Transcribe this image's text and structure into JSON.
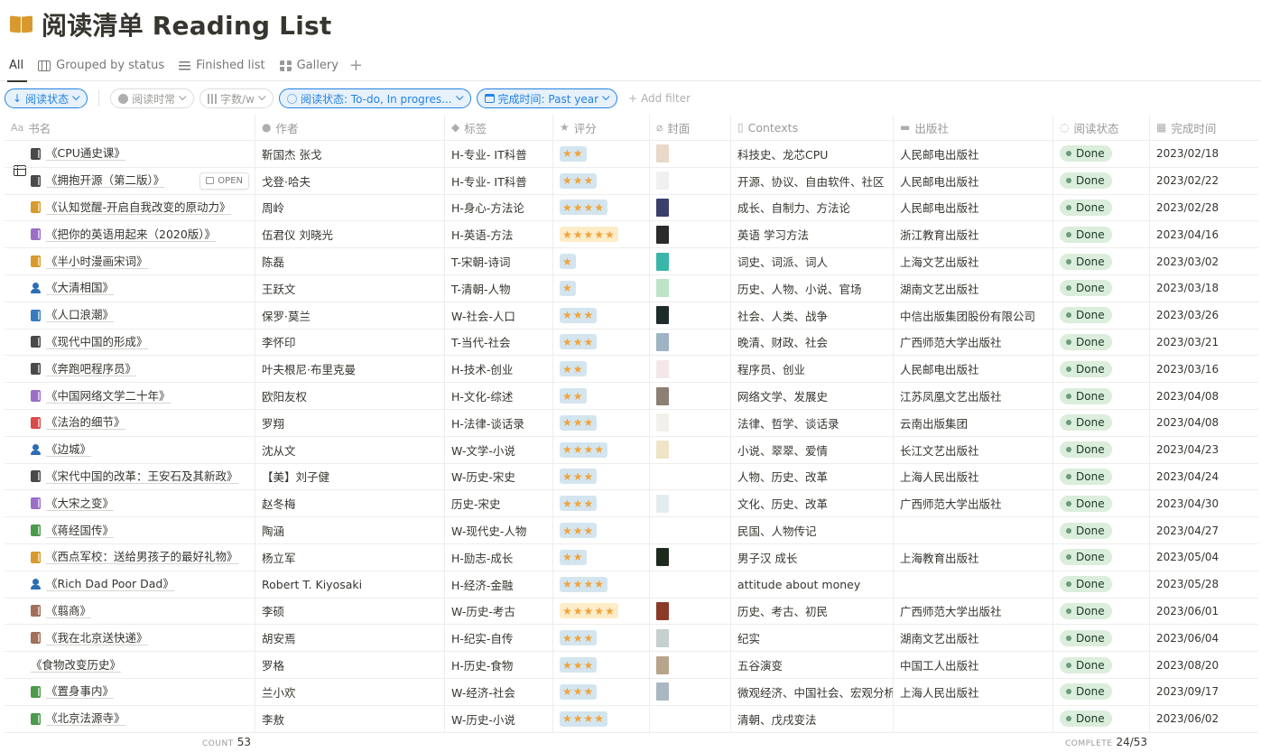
{
  "page": {
    "title": "阅读清单 Reading List",
    "icon": "open-book-icon"
  },
  "views": [
    {
      "label": "All",
      "icon": "table-icon",
      "active": true
    },
    {
      "label": "Grouped by status",
      "icon": "board-icon"
    },
    {
      "label": "Finished list",
      "icon": "list-icon"
    },
    {
      "label": "Gallery",
      "icon": "gallery-icon"
    }
  ],
  "filters": {
    "sort": "阅读状态",
    "f1": "阅读时常",
    "f2": "字数/w",
    "f3": "阅读状态: To-do, In progres...",
    "f4": "完成时间: Past year",
    "add": "Add filter"
  },
  "columns": {
    "name": "书名",
    "author": "作者",
    "tag": "标签",
    "rating": "评分",
    "cover": "封面",
    "contexts": "Contexts",
    "publisher": "出版社",
    "status": "阅读状态",
    "date": "完成时间"
  },
  "open_label": "OPEN",
  "rows": [
    {
      "name": "《CPU通史课》",
      "icon": "book",
      "color": "#4a4a4a",
      "author": "靳国杰 张戈",
      "tag": "H-专业- IT科普",
      "stars": "★★",
      "cover": "#e8d9c9",
      "ctx": "科技史、龙芯CPU",
      "pub": "人民邮电出版社",
      "status": "Done",
      "date": "2023/02/18"
    },
    {
      "name": "《拥抱开源（第二版）》",
      "icon": "book",
      "color": "#4a4a4a",
      "author": "戈登·哈夫",
      "tag": "H-专业- IT科普",
      "stars": "★★★",
      "cover": "#f0f0f0",
      "ctx": "开源、协议、自由软件、社区",
      "pub": "人民邮电出版社",
      "status": "Done",
      "date": "2023/02/22"
    },
    {
      "name": "《认知觉醒-开启自我改变的原动力》",
      "icon": "book",
      "color": "#d89a2e",
      "author": "周岭",
      "tag": "H-身心-方法论",
      "stars": "★★★★",
      "cover": "#3b3f6b",
      "ctx": "成长、自制力、方法论",
      "pub": "人民邮电出版社",
      "status": "Done",
      "date": "2023/02/28"
    },
    {
      "name": "《把你的英语用起来（2020版）》",
      "icon": "book",
      "color": "#9b6fc8",
      "author": "伍君仪 刘晓光",
      "tag": "H-英语-方法",
      "stars": "★★★★★",
      "stars_alt": true,
      "cover": "#2b2b2b",
      "ctx": "英语 学习方法",
      "pub": "浙江教育出版社",
      "status": "Done",
      "date": "2023/04/16"
    },
    {
      "name": "《半小时漫画宋词》",
      "icon": "book",
      "color": "#d89a2e",
      "author": "陈磊",
      "tag": "T-宋朝-诗词",
      "stars": "★",
      "cover": "#39b6a8",
      "ctx": "词史、词派、词人",
      "pub": "上海文艺出版社",
      "status": "Done",
      "date": "2023/03/02"
    },
    {
      "name": "《大清相国》",
      "icon": "person",
      "color": "#2c6db5",
      "author": "王跃文",
      "tag": "T-清朝-人物",
      "stars": "★",
      "cover": "#bfe3c7",
      "ctx": "历史、人物、小说、官场",
      "pub": "湖南文艺出版社",
      "status": "Done",
      "date": "2023/03/18"
    },
    {
      "name": "《人口浪潮》",
      "icon": "book",
      "color": "#3a7bbf",
      "author": "保罗·莫兰",
      "tag": "W-社会-人口",
      "stars": "★★★",
      "cover": "#1d2b2a",
      "ctx": "社会、人类、战争",
      "pub": "中信出版集团股份有限公司",
      "status": "Done",
      "date": "2023/03/26"
    },
    {
      "name": "《现代中国的形成》",
      "icon": "book",
      "color": "#4a4a4a",
      "author": "李怀印",
      "tag": "T-当代-社会",
      "stars": "★★★",
      "cover": "#9fb3c4",
      "ctx": "晚清、财政、社会",
      "pub": "广西师范大学出版社",
      "status": "Done",
      "date": "2023/03/21"
    },
    {
      "name": "《奔跑吧程序员》",
      "icon": "book",
      "color": "#4a4a4a",
      "author": "叶夫根尼·布里克曼",
      "tag": "H-技术-创业",
      "stars": "★★",
      "cover": "#f3e7ea",
      "ctx": "程序员、创业",
      "pub": "人民邮电出版社",
      "status": "Done",
      "date": "2023/03/16"
    },
    {
      "name": "《中国网络文学二十年》",
      "icon": "book",
      "color": "#9b6fc8",
      "author": "欧阳友权",
      "tag": "H-文化-综述",
      "stars": "★★",
      "cover": "#8c7f73",
      "ctx": "网络文学、发展史",
      "pub": "江苏凤凰文艺出版社",
      "status": "Done",
      "date": "2023/04/08"
    },
    {
      "name": "《法治的细节》",
      "icon": "book",
      "color": "#d94a4a",
      "author": "罗翔",
      "tag": "H-法律-谈话录",
      "stars": "★★★",
      "cover": "#f2f0ea",
      "ctx": "法律、哲学、谈话录",
      "pub": "云南出版集团",
      "status": "Done",
      "date": "2023/04/08"
    },
    {
      "name": "《边城》",
      "icon": "person",
      "color": "#2c6db5",
      "author": "沈从文",
      "tag": "W-文学-小说",
      "stars": "★★★★",
      "cover": "#efe3c8",
      "ctx": "小说、翠翠、爱情",
      "pub": "长江文艺出版社",
      "status": "Done",
      "date": "2023/04/23"
    },
    {
      "name": "《宋代中国的改革：王安石及其新政》",
      "icon": "book",
      "color": "#4a4a4a",
      "author": "【美】刘子健",
      "tag": "W-历史-宋史",
      "stars": "★★★",
      "cover": "",
      "ctx": "人物、历史、改革",
      "pub": "上海人民出版社",
      "status": "Done",
      "date": "2023/04/24"
    },
    {
      "name": "《大宋之变》",
      "icon": "book",
      "color": "#9b6fc8",
      "author": "赵冬梅",
      "tag": "历史-宋史",
      "stars": "★★★",
      "cover": "#e4ebee",
      "ctx": "文化、历史、改革",
      "pub": "广西师范大学出版社",
      "status": "Done",
      "date": "2023/04/30"
    },
    {
      "name": "《蒋经国传》",
      "icon": "book",
      "color": "#4c9a4c",
      "author": "陶涵",
      "tag": "W-现代史-人物",
      "stars": "★★★",
      "cover": "",
      "ctx": "民国、人物传记",
      "pub": "",
      "status": "Done",
      "date": "2023/04/27"
    },
    {
      "name": "《西点军校：送给男孩子的最好礼物》",
      "icon": "book",
      "color": "#d89a2e",
      "author": "杨立军",
      "tag": "H-励志-成长",
      "stars": "★★",
      "cover": "#1f2a1f",
      "ctx": "男子汉 成长",
      "pub": "上海教育出版社",
      "status": "Done",
      "date": "2023/05/04"
    },
    {
      "name": "《Rich Dad Poor Dad》",
      "icon": "person",
      "color": "#2c6db5",
      "author": "Robert T. Kiyosaki",
      "tag": "H-经济-金融",
      "stars": "★★★★",
      "cover": "",
      "ctx": "attitude about money",
      "pub": "",
      "status": "Done",
      "date": "2023/05/28"
    },
    {
      "name": "《翦商》",
      "icon": "book",
      "color": "#a0705a",
      "author": "李硕",
      "tag": "W-历史-考古",
      "stars": "★★★★★",
      "stars_alt": true,
      "cover": "#8b3a2a",
      "ctx": "历史、考古、初民",
      "pub": "广西师范大学出版社",
      "status": "Done",
      "date": "2023/06/01"
    },
    {
      "name": "《我在北京送快递》",
      "icon": "book",
      "color": "#a0705a",
      "author": "胡安焉",
      "tag": "H-纪实-自传",
      "stars": "★★★",
      "cover": "#c5d0cf",
      "ctx": "纪实",
      "pub": "湖南文艺出版社",
      "status": "Done",
      "date": "2023/06/04"
    },
    {
      "name": "《食物改变历史》",
      "icon": "none",
      "color": "",
      "author": "罗格",
      "tag": "H-历史-食物",
      "stars": "★★★",
      "cover": "#b7a48a",
      "ctx": "五谷演变",
      "pub": "中国工人出版社",
      "status": "Done",
      "date": "2023/08/20"
    },
    {
      "name": "《置身事内》",
      "icon": "book",
      "color": "#4c9a4c",
      "author": "兰小欢",
      "tag": "W-经济-社会",
      "stars": "★★★",
      "cover": "#aab7c2",
      "ctx": "微观经济、中国社会、宏观分析",
      "pub": "上海人民出版社",
      "status": "Done",
      "date": "2023/09/17"
    },
    {
      "name": "《北京法源寺》",
      "icon": "book",
      "color": "#4c9a4c",
      "author": "李敖",
      "tag": "W-历史-小说",
      "stars": "★★★★",
      "cover": "",
      "ctx": "清朝、戊戌变法",
      "pub": "",
      "status": "Done",
      "date": "2023/06/02"
    }
  ],
  "footer": {
    "count_label": "COUNT",
    "count_value": "53",
    "complete_label": "COMPLETE",
    "complete_value": "24/53"
  }
}
